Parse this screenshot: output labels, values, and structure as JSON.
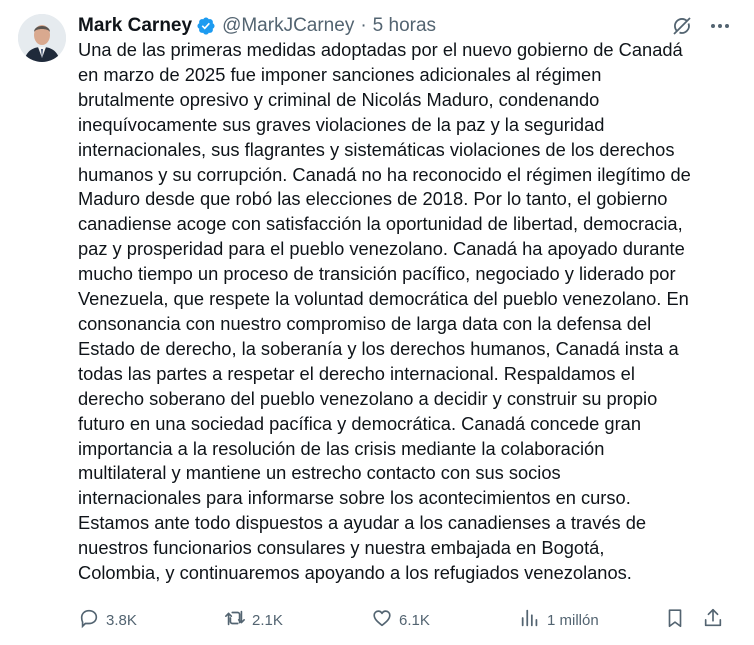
{
  "author": {
    "name": "Mark Carney",
    "handle": "@MarkJCarney",
    "separator": "·",
    "time": "5 horas"
  },
  "icons": {
    "verified": "verified-badge-icon",
    "grok": "grok-icon",
    "more": "more-icon",
    "reply": "reply-icon",
    "retweet": "retweet-icon",
    "like": "heart-icon",
    "views": "views-icon",
    "bookmark": "bookmark-icon",
    "share": "share-icon"
  },
  "colors": {
    "verified": "#1d9bf0",
    "text": "#0f1419",
    "secondary": "#536471"
  },
  "tweet": {
    "text": "Una de las primeras medidas adoptadas por el nuevo gobierno de Canadá\nen marzo de 2025 fue imponer sanciones adicionales al régimen\nbrutalmente opresivo y criminal de Nicolás Maduro, condenando\ninequívocamente sus graves violaciones de la paz y la seguridad\ninternacionales, sus flagrantes y sistemáticas violaciones de los derechos\nhumanos y su corrupción. Canadá no ha reconocido el régimen ilegítimo de\nMaduro desde que robó las elecciones de 2018. Por lo tanto, el gobierno\ncanadiense acoge con satisfacción la oportunidad de libertad, democracia,\npaz y prosperidad para el pueblo venezolano. Canadá ha apoyado durante\nmucho tiempo un proceso de transición pacífico, negociado y liderado por\nVenezuela, que respete la voluntad democrática del pueblo venezolano. En\nconsonancia con nuestro compromiso de larga data con la defensa del\nEstado de derecho, la soberanía y los derechos humanos, Canadá insta a\ntodas las partes a respetar el derecho internacional. Respaldamos el\nderecho soberano del pueblo venezolano a decidir y construir su propio\nfuturo en una sociedad pacífica y democrática. Canadá concede gran\nimportancia a la resolución de las crisis mediante la colaboración\nmultilateral y mantiene un estrecho contacto con sus socios\ninternacionales para informarse sobre los acontecimientos en curso.\nEstamos ante todo dispuestos a ayudar a los canadienses a través de\nnuestros funcionarios consulares y nuestra embajada en Bogotá,\nColombia, y continuaremos apoyando a los refugiados venezolanos."
  },
  "stats": {
    "replies": "3.8K",
    "retweets": "2.1K",
    "likes": "6.1K",
    "views": "1 millón"
  }
}
